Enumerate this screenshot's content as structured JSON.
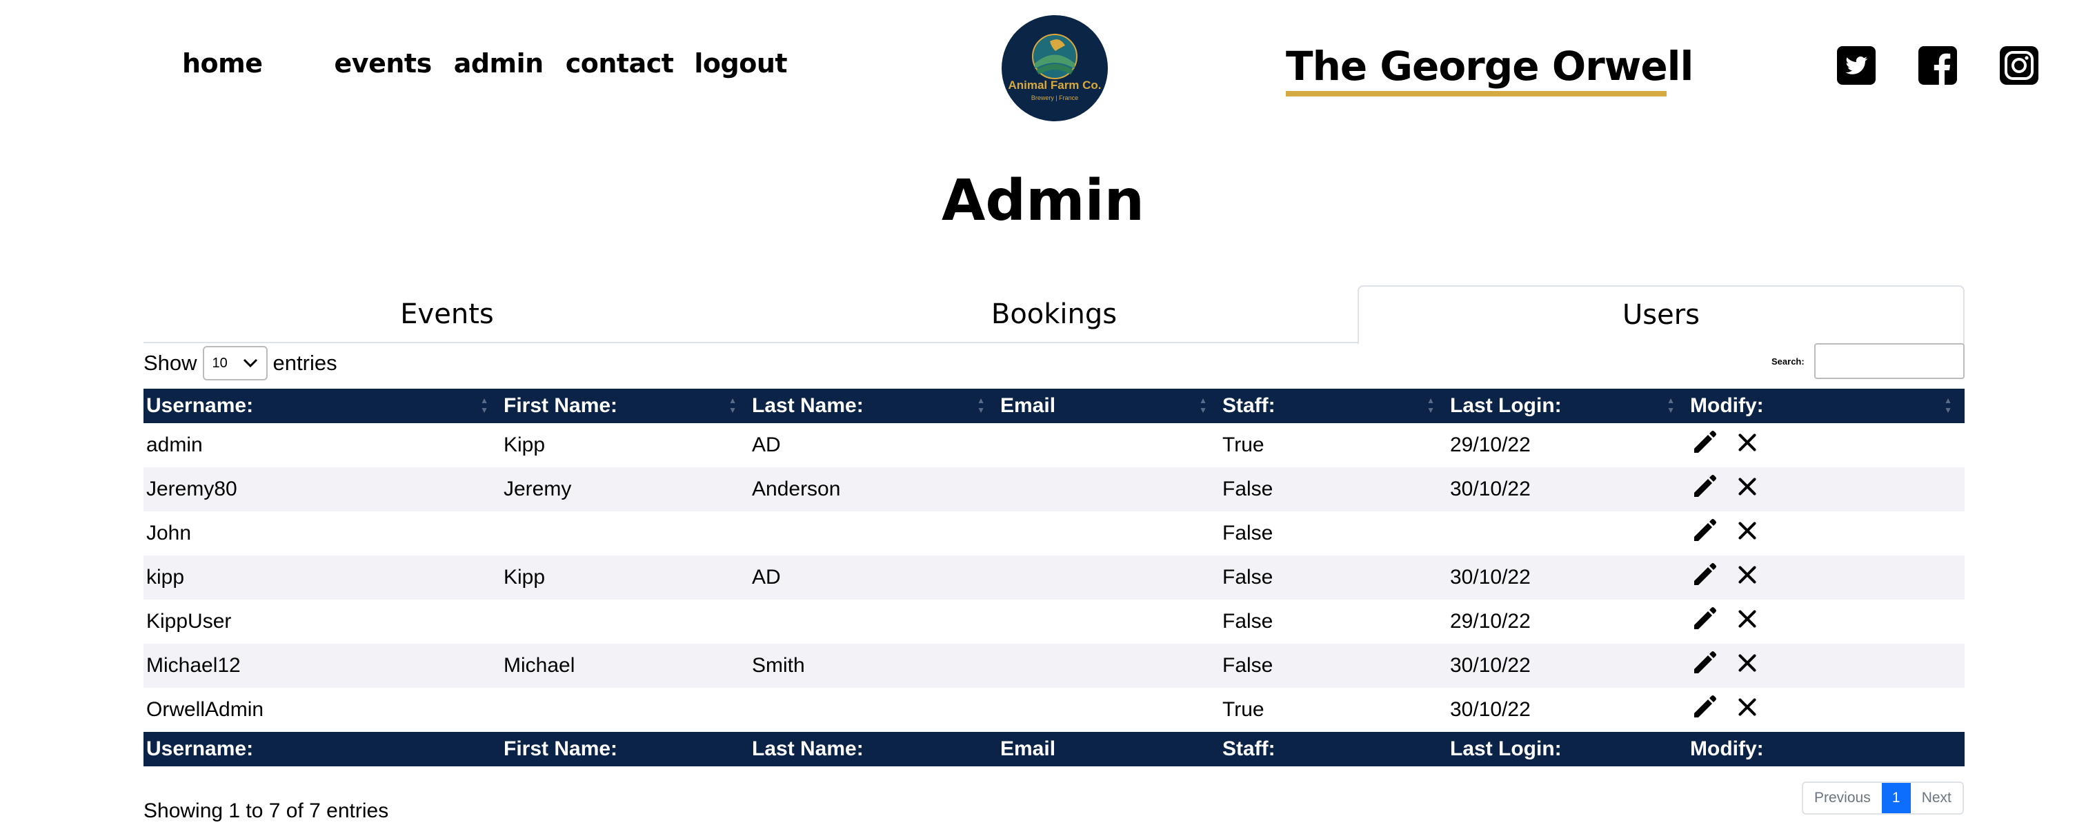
{
  "nav": {
    "items": [
      "home",
      "events",
      "admin",
      "contact",
      "logout"
    ]
  },
  "logo": {
    "text": "Animal Farm Co.",
    "sub": "Brewery | France"
  },
  "brand": {
    "title": "The George Orwell"
  },
  "social": {
    "icons": [
      "twitter-icon",
      "facebook-icon",
      "instagram-icon"
    ]
  },
  "page": {
    "title": "Admin"
  },
  "tabs": [
    {
      "label": "Events",
      "active": false
    },
    {
      "label": "Bookings",
      "active": false
    },
    {
      "label": "Users",
      "active": true
    }
  ],
  "controls": {
    "show_label": "Show",
    "entries_label": "entries",
    "page_length": "10",
    "search_label": "Search:",
    "search_value": ""
  },
  "table": {
    "headers": [
      "Username:",
      "First Name:",
      "Last Name:",
      "Email",
      "Staff:",
      "Last Login:",
      "Modify:"
    ],
    "rows": [
      [
        "admin",
        "Kipp",
        "AD",
        "",
        "True",
        "29/10/22"
      ],
      [
        "Jeremy80",
        "Jeremy",
        "Anderson",
        "",
        "False",
        "30/10/22"
      ],
      [
        "John",
        "",
        "",
        "",
        "False",
        ""
      ],
      [
        "kipp",
        "Kipp",
        "AD",
        "",
        "False",
        "30/10/22"
      ],
      [
        "KippUser",
        "",
        "",
        "",
        "False",
        "29/10/22"
      ],
      [
        "Michael12",
        "Michael",
        "Smith",
        "",
        "False",
        "30/10/22"
      ],
      [
        "OrwellAdmin",
        "",
        "",
        "",
        "True",
        "30/10/22"
      ]
    ]
  },
  "footer": {
    "info": "Showing 1 to 7 of 7 entries",
    "prev": "Previous",
    "page": "1",
    "next": "Next"
  },
  "colors": {
    "navy": "#0b2346",
    "gold": "#d4a942",
    "accent": "#0d6efd"
  }
}
